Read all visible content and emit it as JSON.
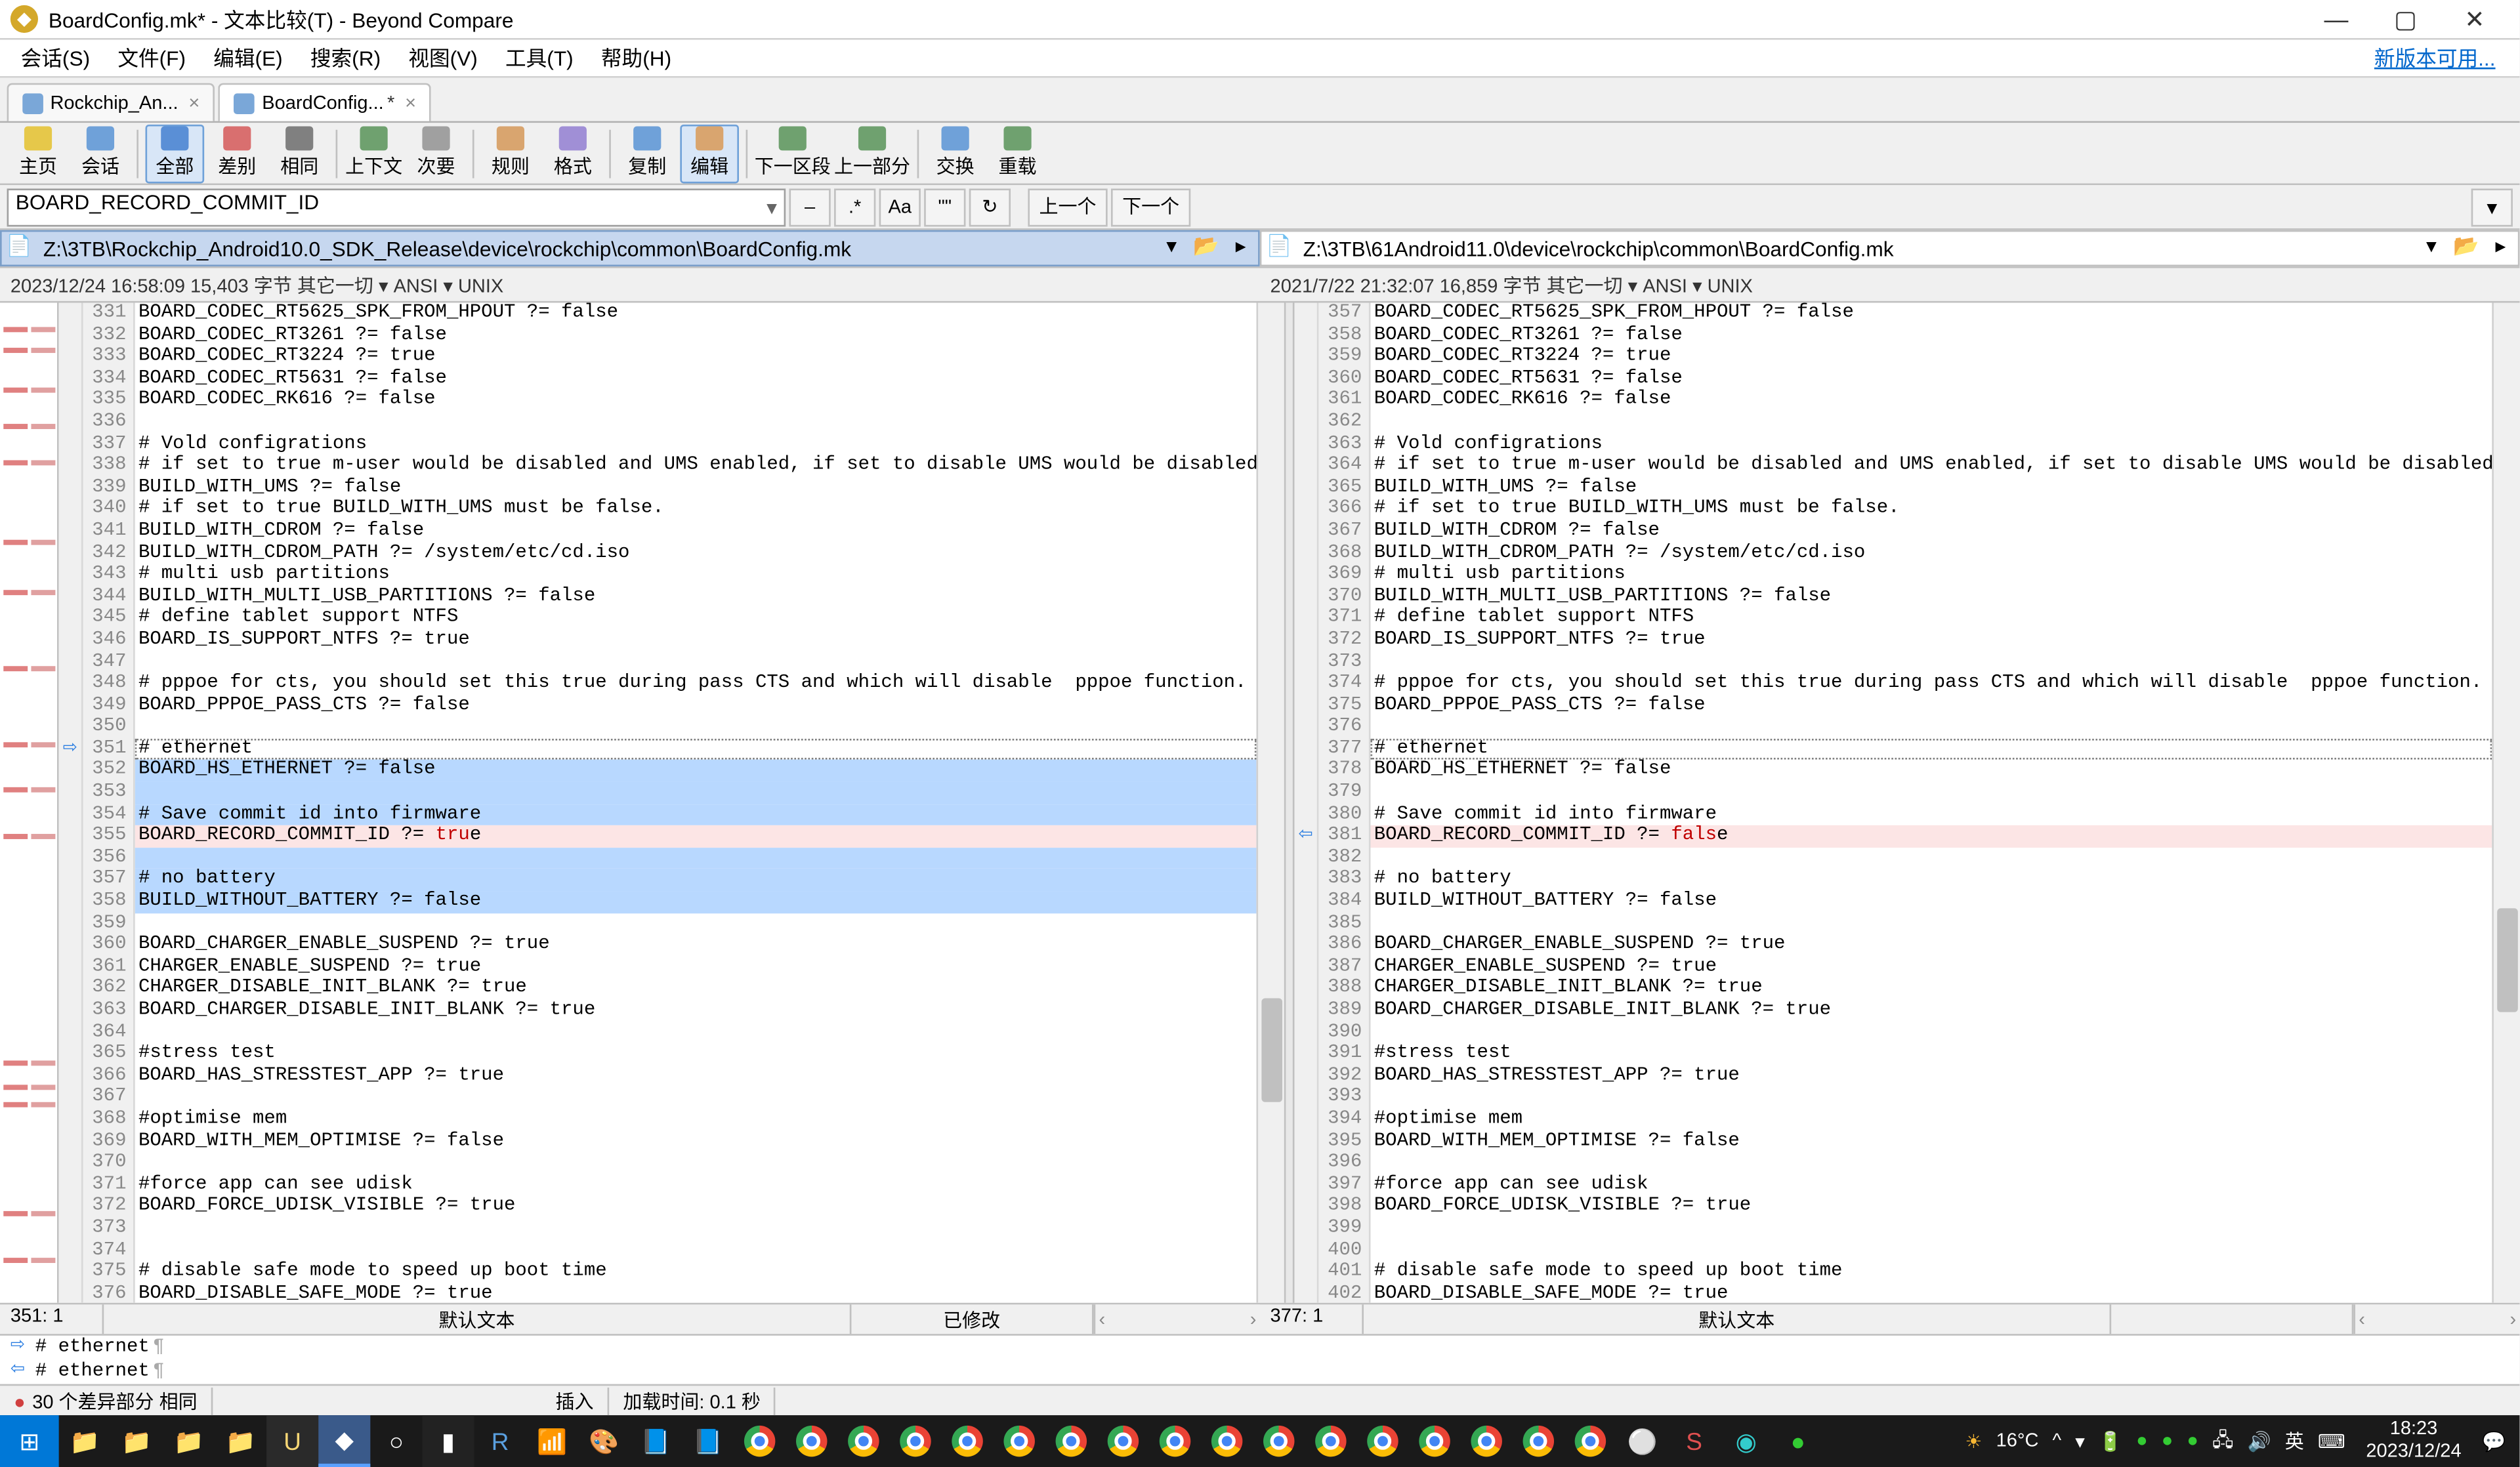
{
  "title": "BoardConfig.mk* - 文本比较(T) - Beyond Compare",
  "menu": [
    "会话(S)",
    "文件(F)",
    "编辑(E)",
    "搜索(R)",
    "视图(V)",
    "工具(T)",
    "帮助(H)"
  ],
  "update_link": "新版本可用...",
  "tabs": [
    {
      "label": "Rockchip_An...",
      "active": false,
      "dirty": false
    },
    {
      "label": "BoardConfig...",
      "active": true,
      "dirty": true
    }
  ],
  "toolbar": [
    {
      "label": "主页",
      "color": "#e6c84a"
    },
    {
      "label": "会话",
      "color": "#6fa1d9"
    },
    {
      "label": "全部",
      "color": "#5a8fd6",
      "active": true
    },
    {
      "label": "差别",
      "color": "#d96f6f"
    },
    {
      "label": "相同",
      "color": "#808080"
    },
    {
      "label": "上下文",
      "color": "#6fa16f"
    },
    {
      "label": "次要",
      "color": "#a0a0a0"
    },
    {
      "label": "规则",
      "color": "#d9a56f"
    },
    {
      "label": "格式",
      "color": "#a08fd6"
    },
    {
      "label": "复制",
      "color": "#6fa1d9"
    },
    {
      "label": "编辑",
      "color": "#d9a56f",
      "active": true
    },
    {
      "label": "下一区段",
      "color": "#6fa16f"
    },
    {
      "label": "上一部分",
      "color": "#6fa16f"
    },
    {
      "label": "交换",
      "color": "#6fa1d9"
    },
    {
      "label": "重载",
      "color": "#6fa16f"
    }
  ],
  "search_value": "BOARD_RECORD_COMMIT_ID",
  "search_btns_small": [
    "–",
    ".*",
    "Aa",
    "\"\"",
    "↻"
  ],
  "search_btns_nav": [
    "上一个",
    "下一个"
  ],
  "paths": {
    "left": "Z:\\3TB\\Rockchip_Android10.0_SDK_Release\\device\\rockchip\\common\\BoardConfig.mk",
    "right": "Z:\\3TB\\61Android11.0\\device\\rockchip\\common\\BoardConfig.mk"
  },
  "meta": {
    "left": "2023/12/24 16:58:09   15,403 字节   其它一切 ▾  ANSI ▾  UNIX",
    "right": "2021/7/22 21:32:07   16,859 字节   其它一切 ▾  ANSI ▾  UNIX"
  },
  "left_start": 331,
  "right_start": 357,
  "left_lines": [
    {
      "t": "BOARD_CODEC_RT5625_SPK_FROM_HPOUT ?= false"
    },
    {
      "t": "BOARD_CODEC_RT3261 ?= false"
    },
    {
      "t": "BOARD_CODEC_RT3224 ?= true"
    },
    {
      "t": "BOARD_CODEC_RT5631 ?= false"
    },
    {
      "t": "BOARD_CODEC_RK616 ?= false"
    },
    {
      "t": ""
    },
    {
      "t": "# Vold configrations"
    },
    {
      "t": "# if set to true m-user would be disabled and UMS enabled, if set to disable UMS would be disabled and m-user enabled"
    },
    {
      "t": "BUILD_WITH_UMS ?= false"
    },
    {
      "t": "# if set to true BUILD_WITH_UMS must be false."
    },
    {
      "t": "BUILD_WITH_CDROM ?= false"
    },
    {
      "t": "BUILD_WITH_CDROM_PATH ?= /system/etc/cd.iso"
    },
    {
      "t": "# multi usb partitions"
    },
    {
      "t": "BUILD_WITH_MULTI_USB_PARTITIONS ?= false"
    },
    {
      "t": "# define tablet support NTFS"
    },
    {
      "t": "BOARD_IS_SUPPORT_NTFS ?= true"
    },
    {
      "t": ""
    },
    {
      "t": "# pppoe for cts, you should set this true during pass CTS and which will disable  pppoe function."
    },
    {
      "t": "BOARD_PPPOE_PASS_CTS ?= false"
    },
    {
      "t": ""
    },
    {
      "t": "# ethernet",
      "sel": true,
      "cur": true,
      "mark": "⇨"
    },
    {
      "t": "BOARD_HS_ETHERNET ?= false",
      "sel": true
    },
    {
      "t": "",
      "sel": true
    },
    {
      "t": "# Save commit id into firmware",
      "sel": true
    },
    {
      "t": "BOARD_RECORD_COMMIT_ID ?= true",
      "sel": true,
      "diff": true,
      "dword": "tru"
    },
    {
      "t": "",
      "sel": true
    },
    {
      "t": "# no battery",
      "sel": true
    },
    {
      "t": "BUILD_WITHOUT_BATTERY ?= false",
      "sel": true
    },
    {
      "t": ""
    },
    {
      "t": "BOARD_CHARGER_ENABLE_SUSPEND ?= true"
    },
    {
      "t": "CHARGER_ENABLE_SUSPEND ?= true"
    },
    {
      "t": "CHARGER_DISABLE_INIT_BLANK ?= true"
    },
    {
      "t": "BOARD_CHARGER_DISABLE_INIT_BLANK ?= true"
    },
    {
      "t": ""
    },
    {
      "t": "#stress test"
    },
    {
      "t": "BOARD_HAS_STRESSTEST_APP ?= true"
    },
    {
      "t": ""
    },
    {
      "t": "#optimise mem"
    },
    {
      "t": "BOARD_WITH_MEM_OPTIMISE ?= false"
    },
    {
      "t": ""
    },
    {
      "t": "#force app can see udisk"
    },
    {
      "t": "BOARD_FORCE_UDISK_VISIBLE ?= true"
    },
    {
      "t": ""
    },
    {
      "t": ""
    },
    {
      "t": "# disable safe mode to speed up boot time"
    },
    {
      "t": "BOARD_DISABLE_SAFE_MODE ?= true"
    }
  ],
  "right_lines": [
    {
      "t": "BOARD_CODEC_RT5625_SPK_FROM_HPOUT ?= false"
    },
    {
      "t": "BOARD_CODEC_RT3261 ?= false"
    },
    {
      "t": "BOARD_CODEC_RT3224 ?= true"
    },
    {
      "t": "BOARD_CODEC_RT5631 ?= false"
    },
    {
      "t": "BOARD_CODEC_RK616 ?= false"
    },
    {
      "t": ""
    },
    {
      "t": "# Vold configrations"
    },
    {
      "t": "# if set to true m-user would be disabled and UMS enabled, if set to disable UMS would be disabled and m-user enabled"
    },
    {
      "t": "BUILD_WITH_UMS ?= false"
    },
    {
      "t": "# if set to true BUILD_WITH_UMS must be false."
    },
    {
      "t": "BUILD_WITH_CDROM ?= false"
    },
    {
      "t": "BUILD_WITH_CDROM_PATH ?= /system/etc/cd.iso"
    },
    {
      "t": "# multi usb partitions"
    },
    {
      "t": "BUILD_WITH_MULTI_USB_PARTITIONS ?= false"
    },
    {
      "t": "# define tablet support NTFS"
    },
    {
      "t": "BOARD_IS_SUPPORT_NTFS ?= true"
    },
    {
      "t": ""
    },
    {
      "t": "# pppoe for cts, you should set this true during pass CTS and which will disable  pppoe function."
    },
    {
      "t": "BOARD_PPPOE_PASS_CTS ?= false"
    },
    {
      "t": ""
    },
    {
      "t": "# ethernet",
      "cur": true
    },
    {
      "t": "BOARD_HS_ETHERNET ?= false"
    },
    {
      "t": ""
    },
    {
      "t": "# Save commit id into firmware"
    },
    {
      "t": "BOARD_RECORD_COMMIT_ID ?= false",
      "diff": true,
      "dword": "fals",
      "mark": "⇦"
    },
    {
      "t": ""
    },
    {
      "t": "# no battery"
    },
    {
      "t": "BUILD_WITHOUT_BATTERY ?= false"
    },
    {
      "t": ""
    },
    {
      "t": "BOARD_CHARGER_ENABLE_SUSPEND ?= true"
    },
    {
      "t": "CHARGER_ENABLE_SUSPEND ?= true"
    },
    {
      "t": "CHARGER_DISABLE_INIT_BLANK ?= true"
    },
    {
      "t": "BOARD_CHARGER_DISABLE_INIT_BLANK ?= true"
    },
    {
      "t": ""
    },
    {
      "t": "#stress test"
    },
    {
      "t": "BOARD_HAS_STRESSTEST_APP ?= true"
    },
    {
      "t": ""
    },
    {
      "t": "#optimise mem"
    },
    {
      "t": "BOARD_WITH_MEM_OPTIMISE ?= false"
    },
    {
      "t": ""
    },
    {
      "t": "#force app can see udisk"
    },
    {
      "t": "BOARD_FORCE_UDISK_VISIBLE ?= true"
    },
    {
      "t": ""
    },
    {
      "t": ""
    },
    {
      "t": "# disable safe mode to speed up boot time"
    },
    {
      "t": "BOARD_DISABLE_SAFE_MODE ?= true"
    }
  ],
  "status_left": {
    "pos": "351: 1",
    "mode": "默认文本",
    "state": "已修改"
  },
  "status_right": {
    "pos": "377: 1",
    "mode": "默认文本",
    "state": ""
  },
  "merge_line": "# ethernet",
  "bottom": {
    "diff": "30 个差异部分   相同",
    "insert": "插入",
    "load": "加载时间: 0.1 秒"
  },
  "tray": {
    "temp": "16°C",
    "ime": "英",
    "time": "18:23",
    "date": "2023/12/24"
  }
}
